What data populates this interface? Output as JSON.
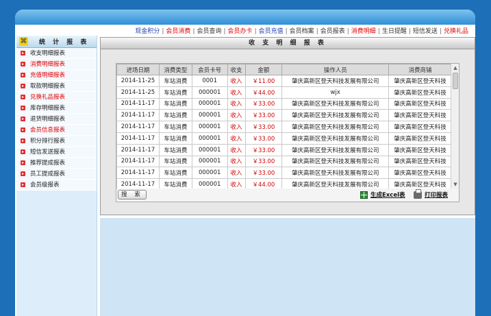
{
  "topnav": [
    {
      "label": "现金积分",
      "color": "#1f3fb0"
    },
    {
      "label": "会员消费",
      "color": "#e00000"
    },
    {
      "label": "会员查询",
      "color": "#333333"
    },
    {
      "label": "会员办卡",
      "color": "#e00000"
    },
    {
      "label": "会员充值",
      "color": "#1f3fb0"
    },
    {
      "label": "会员档案",
      "color": "#333333"
    },
    {
      "label": "会员报表",
      "color": "#333333"
    },
    {
      "label": "消费明细",
      "color": "#e00000"
    },
    {
      "label": "生日提醒",
      "color": "#333333"
    },
    {
      "label": "短信发送",
      "color": "#333333"
    },
    {
      "label": "兑换礼品",
      "color": "#e00000"
    }
  ],
  "sidebar": {
    "title": "统 计 报 表",
    "items": [
      {
        "label": "收支明细报表",
        "red": false
      },
      {
        "label": "消费明细报表",
        "red": true
      },
      {
        "label": "充值明细报表",
        "red": true
      },
      {
        "label": "取款明细报表",
        "red": false
      },
      {
        "label": "兑换礼品报表",
        "red": true
      },
      {
        "label": "库存明细报表",
        "red": false
      },
      {
        "label": "退货明细报表",
        "red": false
      },
      {
        "label": "会员信息报表",
        "red": true
      },
      {
        "label": "积分排行报表",
        "red": false
      },
      {
        "label": "短信发送报表",
        "red": false
      },
      {
        "label": "推荐提成报表",
        "red": false
      },
      {
        "label": "员工提成报表",
        "red": false
      },
      {
        "label": "会员级报表",
        "red": false
      }
    ]
  },
  "main": {
    "title": "收 支 明 细 报 表",
    "columns": [
      "进场日期",
      "消费类型",
      "会员卡号",
      "收支",
      "金额",
      "操作人员",
      "消费商铺"
    ],
    "rows": [
      [
        "2014-11-25",
        "车站消费",
        "0001",
        "收入",
        "￥11.00",
        "肇庆高新区登天科技发展有限公司",
        "肇庆高新区登天科技"
      ],
      [
        "2014-11-25",
        "车站消费",
        "000001",
        "收入",
        "￥44.00",
        "wjx",
        "肇庆高新区登天科技"
      ],
      [
        "2014-11-17",
        "车站消费",
        "000001",
        "收入",
        "￥33.00",
        "肇庆高新区登天科技发展有限公司",
        "肇庆高新区登天科技"
      ],
      [
        "2014-11-17",
        "车站消费",
        "000001",
        "收入",
        "￥33.00",
        "肇庆高新区登天科技发展有限公司",
        "肇庆高新区登天科技"
      ],
      [
        "2014-11-17",
        "车站消费",
        "000001",
        "收入",
        "￥33.00",
        "肇庆高新区登天科技发展有限公司",
        "肇庆高新区登天科技"
      ],
      [
        "2014-11-17",
        "车站消费",
        "000001",
        "收入",
        "￥33.00",
        "肇庆高新区登天科技发展有限公司",
        "肇庆高新区登天科技"
      ],
      [
        "2014-11-17",
        "车站消费",
        "000001",
        "收入",
        "￥33.00",
        "肇庆高新区登天科技发展有限公司",
        "肇庆高新区登天科技"
      ],
      [
        "2014-11-17",
        "车站消费",
        "000001",
        "收入",
        "￥33.00",
        "肇庆高新区登天科技发展有限公司",
        "肇庆高新区登天科技"
      ],
      [
        "2014-11-17",
        "车站消费",
        "000001",
        "收入",
        "￥33.00",
        "肇庆高新区登天科技发展有限公司",
        "肇庆高新区登天科技"
      ],
      [
        "2014-11-17",
        "车站消费",
        "000001",
        "收入",
        "￥44.00",
        "肇庆高新区登天科技发展有限公司",
        "肇庆高新区登天科技"
      ]
    ],
    "search_label": "搜 索",
    "excel_label": "生成Excel表",
    "print_label": "打印报表"
  }
}
